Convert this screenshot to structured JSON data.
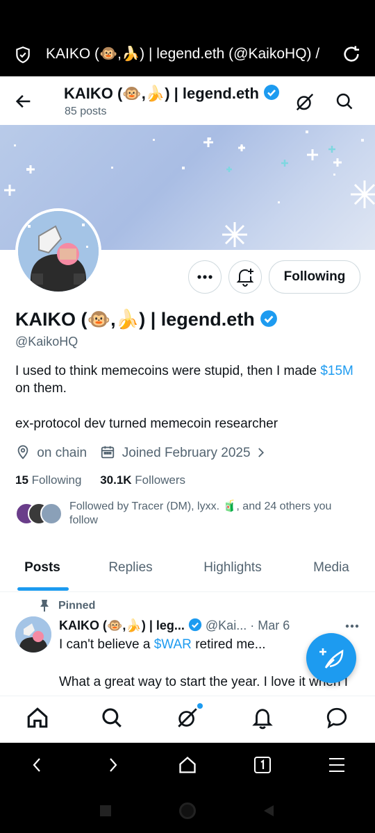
{
  "browser": {
    "url_text": "KAIKO (🐵,🍌) | legend.eth (@KaikoHQ) /",
    "shield_icon": "shield-check-icon",
    "reload_icon": "reload-icon"
  },
  "header": {
    "name": "KAIKO (🐵,🍌) | legend.eth",
    "posts_count": "85 posts"
  },
  "profile": {
    "name": "KAIKO (🐵,🍌) | legend.eth",
    "handle": "@KaikoHQ",
    "bio_part1": "I used to think memecoins were stupid, then I made ",
    "bio_link": "$15M",
    "bio_part2": " on them.",
    "bio_line2": "ex-protocol dev turned memecoin researcher",
    "location": "on chain",
    "joined": "Joined February 2025",
    "following_count": "15",
    "following_label": " Following",
    "followers_count": "30.1K",
    "followers_label": " Followers",
    "followed_by": "Followed by Tracer (DM), lyxx. 🧃, and 24 others you follow"
  },
  "actions": {
    "following_label": "Following"
  },
  "tabs": [
    {
      "label": "Posts"
    },
    {
      "label": "Replies"
    },
    {
      "label": "Highlights"
    },
    {
      "label": "Media"
    }
  ],
  "pinned_post": {
    "pinned_label": "Pinned",
    "author": "KAIKO (🐵,🍌) | leg...",
    "handle": "@Kai...",
    "date": "· Mar 6",
    "text_part1": "I can't believe a ",
    "text_link": "$WAR",
    "text_part2": " retired me...",
    "text_line2": "What a great way to start the year. I love it when I"
  },
  "colors": {
    "accent": "#1d9bf0",
    "muted": "#536471",
    "text": "#0f1419"
  }
}
